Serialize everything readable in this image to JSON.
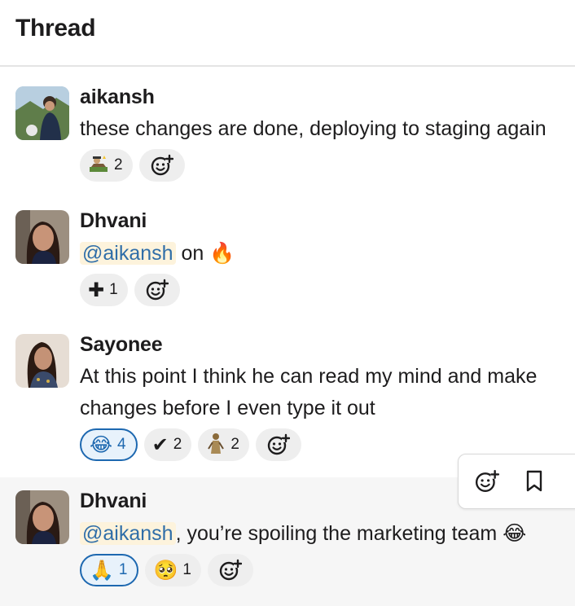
{
  "header": {
    "title": "Thread"
  },
  "messages": [
    {
      "author": "aikansh",
      "text": "these changes are done, deploying to staging again",
      "reactions": [
        {
          "emoji": "ship-it",
          "count": "2"
        }
      ]
    },
    {
      "author": "Dhvani",
      "mention": "@aikansh",
      "text": " on ",
      "inline_emoji": "🔥",
      "reactions": [
        {
          "emoji": "✚",
          "count": "1"
        }
      ]
    },
    {
      "author": "Sayonee",
      "text_line1": "At this point I think he can read my mind and make",
      "text_line2": "changes before I even type it out",
      "reactions": [
        {
          "emoji": "😂",
          "count": "4",
          "mine": true
        },
        {
          "emoji": "✔",
          "count": "2"
        },
        {
          "emoji": "custom-figure",
          "count": "2"
        }
      ]
    },
    {
      "author": "Dhvani",
      "mention": "@aikansh",
      "text": ", you’re spoiling the marketing team ",
      "inline_emoji": "😂",
      "reactions": [
        {
          "emoji": "🙏",
          "count": "1",
          "mine": true
        },
        {
          "emoji": "🥺",
          "count": "1"
        }
      ]
    }
  ],
  "colors": {
    "mention_bg": "#fdf3dc",
    "mention_text": "#2f6ea8",
    "selected_pill_border": "#1d68b0"
  },
  "icons": {
    "add_reaction": "add-reaction-icon",
    "bookmark": "bookmark-icon"
  }
}
